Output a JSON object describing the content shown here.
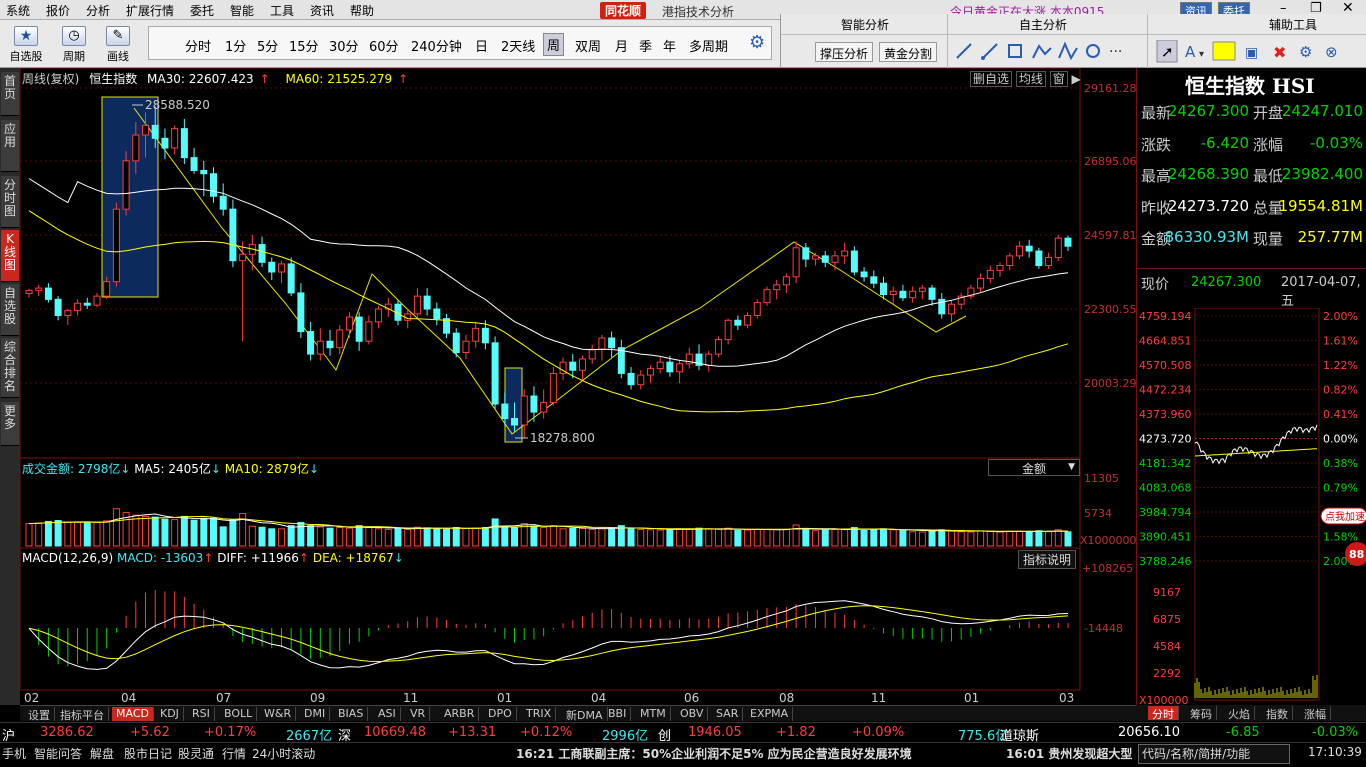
{
  "menu": [
    "系统",
    "报价",
    "分析",
    "扩展行情",
    "委托",
    "智能",
    "工具",
    "资讯",
    "帮助"
  ],
  "app": {
    "logo": "同花顺",
    "title": "港指技术分析",
    "marquee": "今日黄金正在大涨  本本0915",
    "btn_info": "资讯",
    "btn_trade": "委托"
  },
  "toolbar": {
    "groups": [
      {
        "label": "自选股",
        "icon": "star-icon"
      },
      {
        "label": "周期",
        "icon": "clock-icon"
      },
      {
        "label": "画线",
        "icon": "pencil-icon"
      }
    ],
    "periods": [
      "分时",
      "1分",
      "5分",
      "15分",
      "30分",
      "60分",
      "240分钟",
      "日",
      "2天线",
      "周",
      "双周",
      "月",
      "季",
      "年",
      "多周期"
    ],
    "selected_period": "周"
  },
  "panels": {
    "smart": "智能分析",
    "own": "自主分析",
    "aux": "辅助工具",
    "btn1": "撑压分析",
    "btn2": "黄金分割"
  },
  "sidebar": [
    "首页",
    "应用",
    "分时图",
    "K线图",
    "自选股",
    "综合排名",
    "更多"
  ],
  "chart": {
    "legend": {
      "cycle": "周线(复权)",
      "name": "恒生指数",
      "ma30": "MA30: 22607.423",
      "ma60": "MA60: 21525.279"
    },
    "corner_btns": [
      "删自选",
      "均线",
      "窗"
    ],
    "y_labels": [
      "29161.28",
      "26895.06",
      "24597.81",
      "22300.55",
      "20003.29"
    ],
    "y_values": [
      29161.28,
      26895.06,
      24597.81,
      22300.55,
      20003.29
    ],
    "high_label": "28588.520",
    "low_label": "18278.800",
    "vol_legend": {
      "title": "成交金额: 2798亿",
      "ma5": "MA5: 2405亿",
      "ma10": "MA10: 2879亿"
    },
    "vol_dropdown": "金额",
    "vol_y": [
      "11305",
      "5734",
      "X1000000"
    ],
    "macd_legend": {
      "title": "MACD(12,26,9)",
      "macd": "MACD: -13603",
      "diff": "DIFF: +11966",
      "dea": "DEA: +18767"
    },
    "macd_btn": "指标说明",
    "macd_y": [
      "+108265",
      "-14448"
    ],
    "x_labels": [
      "02",
      "04",
      "07",
      "09",
      "11",
      "01",
      "04",
      "06",
      "08",
      "11",
      "01",
      "03"
    ],
    "colors": {
      "up": "#ff3c3c",
      "down": "#54fcfc",
      "ma30": "#ffffff",
      "ma60": "#ffff00"
    },
    "candles": [
      [
        22780,
        22920,
        22650,
        22880
      ],
      [
        22880,
        23050,
        22700,
        22950
      ],
      [
        22950,
        23100,
        22500,
        22600
      ],
      [
        22600,
        22700,
        21950,
        22100
      ],
      [
        22100,
        22300,
        21800,
        22250
      ],
      [
        22250,
        22600,
        22100,
        22480
      ],
      [
        22480,
        22650,
        22300,
        22420
      ],
      [
        22420,
        22800,
        22350,
        22700
      ],
      [
        22700,
        23300,
        22600,
        23150
      ],
      [
        23150,
        25600,
        23000,
        25400
      ],
      [
        25400,
        27200,
        25200,
        26900
      ],
      [
        26900,
        28100,
        26500,
        27700
      ],
      [
        27700,
        28400,
        27000,
        28000
      ],
      [
        28000,
        28588,
        27300,
        27600
      ],
      [
        27600,
        27900,
        26950,
        27300
      ],
      [
        27300,
        28000,
        27100,
        27900
      ],
      [
        27900,
        28200,
        26800,
        27000
      ],
      [
        27000,
        27300,
        26500,
        26600
      ],
      [
        26600,
        26900,
        25800,
        26500
      ],
      [
        26500,
        26700,
        25600,
        25800
      ],
      [
        25800,
        26200,
        25200,
        25400
      ],
      [
        25400,
        25700,
        23600,
        23800
      ],
      [
        23800,
        24400,
        21300,
        24000
      ],
      [
        24000,
        24600,
        23500,
        24300
      ],
      [
        24300,
        24550,
        23600,
        23750
      ],
      [
        23750,
        23900,
        23200,
        23450
      ],
      [
        23450,
        23800,
        23100,
        23700
      ],
      [
        23700,
        23900,
        22700,
        22800
      ],
      [
        22800,
        23100,
        21400,
        21600
      ],
      [
        21600,
        21900,
        20700,
        20900
      ],
      [
        20900,
        21700,
        20700,
        21300
      ],
      [
        21300,
        21650,
        20850,
        21100
      ],
      [
        21100,
        21800,
        20900,
        21650
      ],
      [
        21650,
        22200,
        21400,
        22050
      ],
      [
        22050,
        22200,
        21000,
        21300
      ],
      [
        21300,
        22100,
        21200,
        21900
      ],
      [
        21900,
        22400,
        21700,
        22300
      ],
      [
        22300,
        22650,
        22050,
        22450
      ],
      [
        22450,
        22600,
        21800,
        21950
      ],
      [
        21950,
        22300,
        21700,
        22150
      ],
      [
        22150,
        22950,
        22000,
        22700
      ],
      [
        22700,
        22950,
        22100,
        22300
      ],
      [
        22300,
        22500,
        21800,
        22000
      ],
      [
        22000,
        22150,
        21400,
        21550
      ],
      [
        21550,
        21700,
        20800,
        20950
      ],
      [
        20950,
        21500,
        20750,
        21300
      ],
      [
        21300,
        21900,
        21100,
        21700
      ],
      [
        21700,
        21950,
        21050,
        21250
      ],
      [
        21250,
        21450,
        19200,
        19350
      ],
      [
        19350,
        19700,
        18700,
        18900
      ],
      [
        18900,
        19400,
        18500,
        18700
      ],
      [
        18700,
        19800,
        18278,
        19600
      ],
      [
        19600,
        19900,
        18800,
        19100
      ],
      [
        19100,
        19800,
        18900,
        19400
      ],
      [
        19400,
        20500,
        19300,
        20300
      ],
      [
        20300,
        20800,
        20100,
        20650
      ],
      [
        20650,
        20900,
        20150,
        20400
      ],
      [
        20400,
        20850,
        20100,
        20750
      ],
      [
        20750,
        21200,
        20600,
        21050
      ],
      [
        21050,
        21500,
        20700,
        21400
      ],
      [
        21400,
        21600,
        20800,
        21100
      ],
      [
        21100,
        21350,
        20150,
        20300
      ],
      [
        20300,
        20500,
        19800,
        19950
      ],
      [
        19950,
        20400,
        19800,
        20250
      ],
      [
        20250,
        20550,
        20000,
        20450
      ],
      [
        20450,
        20800,
        20300,
        20650
      ],
      [
        20650,
        20850,
        20200,
        20350
      ],
      [
        20350,
        20700,
        20000,
        20600
      ],
      [
        20600,
        21100,
        20450,
        20900
      ],
      [
        20900,
        21200,
        20400,
        20550
      ],
      [
        20550,
        21000,
        20350,
        20900
      ],
      [
        20900,
        21450,
        20800,
        21350
      ],
      [
        21350,
        22000,
        21200,
        21950
      ],
      [
        21950,
        22100,
        21650,
        21800
      ],
      [
        21800,
        22200,
        21700,
        22100
      ],
      [
        22100,
        22600,
        22000,
        22500
      ],
      [
        22500,
        23000,
        22400,
        22900
      ],
      [
        22900,
        23200,
        22600,
        23050
      ],
      [
        23050,
        23400,
        22800,
        23300
      ],
      [
        23300,
        24400,
        23100,
        24200
      ],
      [
        24200,
        24350,
        23600,
        23850
      ],
      [
        23850,
        24050,
        23650,
        23950
      ],
      [
        23950,
        24100,
        23600,
        23750
      ],
      [
        23750,
        24100,
        23500,
        23950
      ],
      [
        23950,
        24364,
        23700,
        24100
      ],
      [
        24100,
        24250,
        23350,
        23450
      ],
      [
        23450,
        23600,
        23150,
        23300
      ],
      [
        23300,
        23500,
        22950,
        23100
      ],
      [
        23100,
        23300,
        22600,
        22750
      ],
      [
        22750,
        23000,
        22450,
        22850
      ],
      [
        22850,
        23050,
        22550,
        22650
      ],
      [
        22650,
        23000,
        22500,
        22850
      ],
      [
        22850,
        23050,
        22600,
        22950
      ],
      [
        22950,
        23050,
        22400,
        22600
      ],
      [
        22600,
        22800,
        22000,
        22150
      ],
      [
        22150,
        22550,
        21900,
        22450
      ],
      [
        22450,
        22800,
        22300,
        22700
      ],
      [
        22700,
        23050,
        22600,
        22950
      ],
      [
        22950,
        23400,
        22800,
        23250
      ],
      [
        23250,
        23650,
        23100,
        23500
      ],
      [
        23500,
        23750,
        23300,
        23650
      ],
      [
        23650,
        24050,
        23500,
        23950
      ],
      [
        23950,
        24400,
        23850,
        24250
      ],
      [
        24250,
        24450,
        23900,
        24100
      ],
      [
        24100,
        24200,
        23550,
        23650
      ],
      [
        23650,
        24050,
        23550,
        23900
      ],
      [
        23900,
        24600,
        23800,
        24500
      ],
      [
        24500,
        24580,
        24100,
        24250
      ]
    ]
  },
  "quote": {
    "title": "恒生指数 HSI",
    "rows": [
      {
        "k": "最新",
        "v": "24267.300",
        "vc": "grn",
        "k2": "开盘",
        "v2": "24247.010",
        "v2c": "grn"
      },
      {
        "k": "涨跌",
        "v": "-6.420",
        "vc": "grn",
        "k2": "涨幅",
        "v2": "-0.03%",
        "v2c": "grn"
      },
      {
        "k": "最高",
        "v": "24268.390",
        "vc": "grn",
        "k2": "最低",
        "v2": "23982.400",
        "v2c": "grn"
      },
      {
        "k": "昨收",
        "v": "24273.720",
        "vc": "wht",
        "k2": "总量",
        "v2": "19554.81M",
        "v2c": "yel"
      },
      {
        "k": "金额",
        "v": "86330.93M",
        "vc": "cyn",
        "k2": "现量",
        "v2": "257.77M",
        "v2c": "yel"
      }
    ],
    "price_label": "现价",
    "price": "24267.300",
    "date": "2017-04-07,五",
    "mini_y": [
      "4759.194",
      "4664.851",
      "4570.508",
      "4472.234",
      "4373.960",
      "4273.720",
      "4181.342",
      "4083.068",
      "3984.794",
      "3890.451",
      "3788.246"
    ],
    "mini_pct": [
      "2.00%",
      "1.61%",
      "1.22%",
      "0.82%",
      "0.41%",
      "0.00%",
      "0.38%",
      "0.79%",
      "1.18%",
      "1.58%",
      "2.00%"
    ],
    "mini_vol": [
      "9167",
      "6875",
      "4584",
      "2292",
      "X100000"
    ],
    "add_btn": "点我加速",
    "badge": "88"
  },
  "bottom_tabs": [
    "设置",
    "指标平台",
    "MACD",
    "KDJ",
    "RSI",
    "BOLL",
    "W&R",
    "DMI",
    "BIAS",
    "ASI",
    "VR",
    "ARBR",
    "DPO",
    "TRIX",
    "新DMA",
    "BBI",
    "MTM",
    "OBV",
    "SAR",
    "EXPMA"
  ],
  "bottom_tab_selected": "MACD",
  "right_tabs": [
    "分时",
    "筹码",
    "火焰",
    "指数",
    "涨幅"
  ],
  "ticker": {
    "sh": "沪",
    "sh_val": "3286.62",
    "sh_chg": "+5.62",
    "sh_pct": "+0.17%",
    "sh_amt": "2667亿",
    "sz": "深",
    "sz_val": "10669.48",
    "sz_chg": "+13.31",
    "sz_pct": "+0.12%",
    "sz_amt": "2996亿",
    "cy": "创",
    "cy_val": "1946.05",
    "cy_chg": "+1.82",
    "cy_pct": "+0.09%",
    "cy_amt": "775.6亿",
    "dj": "道琼斯",
    "dj_val": "20656.10",
    "dj_chg": "-6.85",
    "dj_pct": "-0.03%"
  },
  "status": {
    "items": [
      "手机",
      "智能问答",
      "解盘",
      "股市日记",
      "股灵通",
      "行情",
      "24小时滚动"
    ],
    "news1": "16:21 工商联副主席：50%企业利润不足5% 应为民企营造良好发展环境",
    "news2": "16:01 贵州发现超大型",
    "search": "代码/名称/简拼/功能",
    "time": "17:10:39"
  }
}
